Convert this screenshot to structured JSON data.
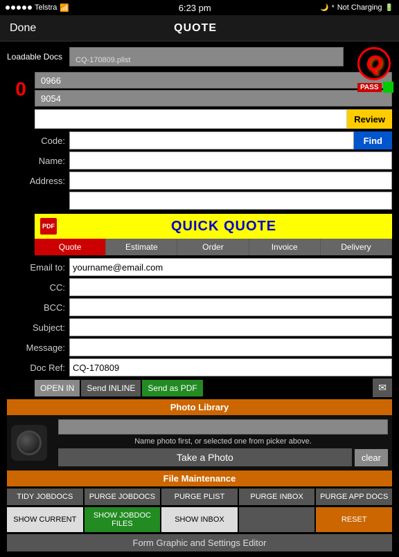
{
  "statusBar": {
    "carrier": "Telstra",
    "time": "6:23 pm",
    "batteryStatus": "Not Charging",
    "wifiIcon": "wifi",
    "bluetoothIcon": "bluetooth"
  },
  "navBar": {
    "doneLabel": "Done",
    "title": "QUOTE"
  },
  "loadableDocs": {
    "label": "Loadable Docs",
    "filename": "CQ-170809.plist"
  },
  "logo": {
    "letter": "Q",
    "passLabel": "PASS"
  },
  "numberSection": {
    "counter": "0",
    "num1": "0966",
    "num2": "9054"
  },
  "reviewFind": {
    "reviewLabel": "Review",
    "findLabel": "Find"
  },
  "codeRow": {
    "label": "Code:"
  },
  "nameRow": {
    "label": "Name:"
  },
  "addressRow": {
    "label": "Address:"
  },
  "quickQuote": {
    "pdfLabel": "PDF",
    "title": "QUICK QUOTE",
    "tabs": [
      "Quote",
      "Estimate",
      "Order",
      "Invoice",
      "Delivery"
    ]
  },
  "emailSection": {
    "emailToLabel": "Email to:",
    "emailToValue": "yourname@email.com",
    "ccLabel": "CC:",
    "bccLabel": "BCC:",
    "subjectLabel": "Subject:",
    "messageLabel": "Message:",
    "docRefLabel": "Doc Ref:",
    "docRefValue": "CQ-170809"
  },
  "sendRow": {
    "openInLabel": "OPEN IN",
    "inlineLabel": "Send INLINE",
    "pdfLabel": "Send as PDF",
    "envelopeIcon": "✉"
  },
  "photoSection": {
    "photoLibraryLabel": "Photo Library",
    "hintText": "Name photo first, or selected one from  picker above.",
    "takePhotoLabel": "Take a Photo",
    "clearLabel": "clear"
  },
  "fileMaintenance": {
    "header": "File Maintenance",
    "row1": [
      "TIDY JOBDOCS",
      "PURGE JOBDOCS",
      "PURGE PLIST",
      "PURGE INBOX",
      "PURGE APP DOCS"
    ],
    "row2": [
      "SHOW CURRENT",
      "SHOW JOBDOC FILES",
      "SHOW INBOX",
      "",
      "RESET"
    ]
  },
  "formEditor": {
    "label": "Form Graphic and Settings Editor"
  }
}
